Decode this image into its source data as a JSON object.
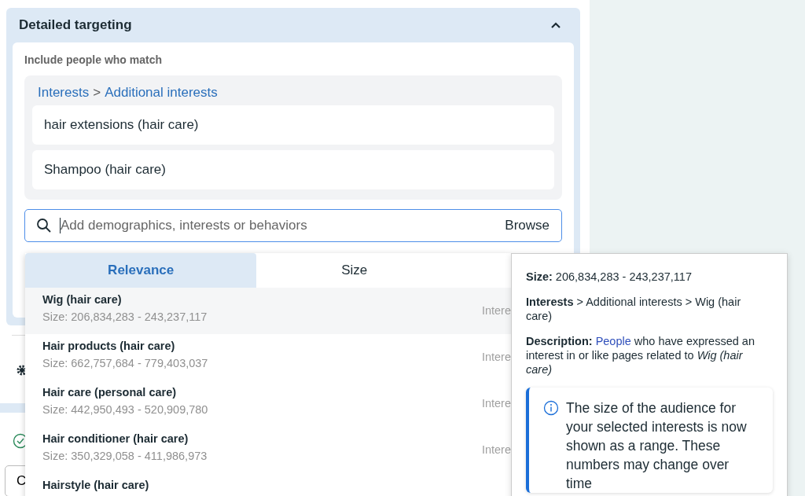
{
  "section": {
    "title": "Detailed targeting",
    "expanded": true
  },
  "include_label": "Include people who match",
  "group": {
    "links": [
      "Interests",
      "Additional interests"
    ],
    "separator": ">"
  },
  "items": [
    "hair extensions (hair care)",
    "Shampoo (hair care)"
  ],
  "search": {
    "placeholder": "Add demographics, interests or behaviors",
    "browse": "Browse"
  },
  "sort_tabs": [
    {
      "label": "Relevance",
      "selected": true
    },
    {
      "label": "Size",
      "selected": false
    }
  ],
  "suggestions": [
    {
      "name": "Wig (hair care)",
      "size": "Size: 206,834,283 - 243,237,117",
      "type": "Intere",
      "selected": true
    },
    {
      "name": "Hair products (hair care)",
      "size": "Size: 662,757,684 - 779,403,037",
      "type": "Intere",
      "selected": false
    },
    {
      "name": "Hair care (personal care)",
      "size": "Size: 442,950,493 - 520,909,780",
      "type": "Intere",
      "selected": false
    },
    {
      "name": "Hair conditioner (hair care)",
      "size": "Size: 350,329,058 - 411,986,973",
      "type": "Intere",
      "selected": false
    },
    {
      "name": "Hairstyle (hair care)",
      "selected": false
    }
  ],
  "tooltip": {
    "size": "**Size:** 206,834,283 - 243,237,117",
    "path": "**Interests** > Additional interests > Wig (hair care)",
    "description": {
      "lead": "**Description:**",
      "link": "People",
      "text": "who have expressed an interest in or like pages related to *Wig (hair care)*"
    },
    "notice": "The size of the audience for your selected interests is now shown as a range. These numbers may change over time"
  },
  "footer_button": "C"
}
